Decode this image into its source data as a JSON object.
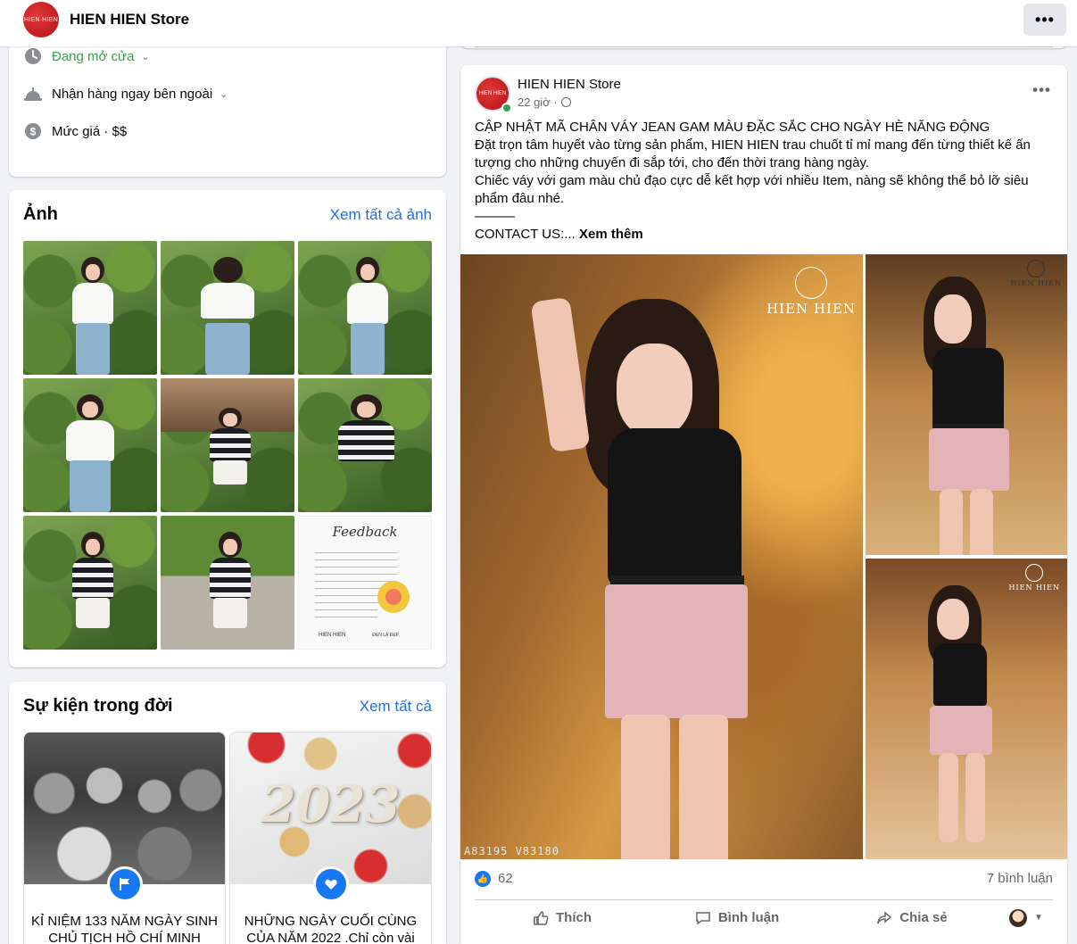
{
  "topbar": {
    "logo_text": "HIEN HIEN",
    "page_name": "HIEN HIEN Store",
    "more_label": "•••"
  },
  "info": {
    "hours": "Đang mở cửa",
    "pickup": "Nhận hàng ngay bên ngoài",
    "price": "Mức giá · $$"
  },
  "photos": {
    "title": "Ảnh",
    "see_all": "Xem tất cả ảnh",
    "feedback_title": "Feedback",
    "feedback_brand": "HIEN HIEN",
    "feedback_tagline": "ĐẸN LÀ ĐẸP"
  },
  "events": {
    "title": "Sự kiện trong đời",
    "see_all": "Xem tất cả",
    "items": [
      {
        "title": "KỈ NIỆM 133 NĂM NGÀY SINH CHỦ TỊCH HỒ CHÍ MINH"
      },
      {
        "title": "NHỮNG NGÀY CUỐI CÙNG CỦA NĂM 2022 .Chỉ còn vài",
        "year": "2023"
      }
    ]
  },
  "post": {
    "author": "HIEN HIEN Store",
    "avatar_text": "HIEN HIEN",
    "time": "22 giờ ·",
    "more_label": "•••",
    "lines": [
      "CẬP NHẬT MÃ CHÂN VÁY JEAN GAM MÀU ĐẶC SẮC CHO NGÀY HÈ NĂNG ĐỘNG",
      "Đặt trọn tâm huyết vào từng sản phẩm, HIEN HIEN trau chuốt tỉ mỉ mang đến từng thiết kế ấn tượng cho những chuyến đi sắp tới, cho đến thời trang hàng ngày.",
      "Chiếc váy với gam màu chủ đạo cực dễ kết hợp với nhiều Item, nàng sẽ không thể bỏ lỡ siêu phẩm đâu nhé.",
      "———",
      "CONTACT US:..."
    ],
    "see_more": "Xem thêm",
    "watermark": "HIEN HIEN",
    "product_code": "A83195  V83180",
    "likes": "62",
    "comments": "7 bình luận",
    "like_label": "Thích",
    "comment_label": "Bình luận",
    "share_label": "Chia sẻ"
  },
  "colors": {
    "link": "#216fdb",
    "open_green": "#31a24c",
    "facebook_blue": "#1877f2"
  }
}
